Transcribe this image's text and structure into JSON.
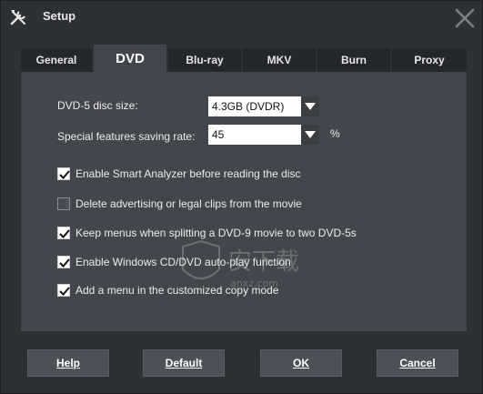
{
  "window": {
    "title": "Setup"
  },
  "tabs": [
    {
      "label": "General"
    },
    {
      "label": "DVD"
    },
    {
      "label": "Blu-ray"
    },
    {
      "label": "MKV"
    },
    {
      "label": "Burn"
    },
    {
      "label": "Proxy"
    }
  ],
  "dvd": {
    "disc_size_label": "DVD-5 disc size:",
    "disc_size_value": "4.3GB (DVDR)",
    "saving_rate_label": "Special features saving rate:",
    "saving_rate_value": "45",
    "saving_rate_unit": "%",
    "options": [
      {
        "label": "Enable Smart Analyzer before reading the disc",
        "checked": true
      },
      {
        "label": "Delete advertising or legal clips from the movie",
        "checked": false
      },
      {
        "label": "Keep menus when splitting a DVD-9 movie to two DVD-5s",
        "checked": true
      },
      {
        "label": "Enable Windows CD/DVD auto-play function",
        "checked": true
      },
      {
        "label": "Add a menu in the customized copy mode",
        "checked": true
      }
    ]
  },
  "buttons": {
    "help": "Help",
    "default": "Default",
    "ok": "OK",
    "cancel": "Cancel"
  },
  "icons": {
    "app": "tools-icon",
    "close": "close-icon",
    "dropdown": "triangle-down-icon",
    "check": "checkmark-icon"
  },
  "colors": {
    "window_bg": "#2d3035",
    "panel_bg": "#43464c",
    "tab_bg": "#24272c",
    "button_bg": "#4d5057"
  },
  "watermark": {
    "text": "安下载",
    "subtext": "anxz.com"
  }
}
